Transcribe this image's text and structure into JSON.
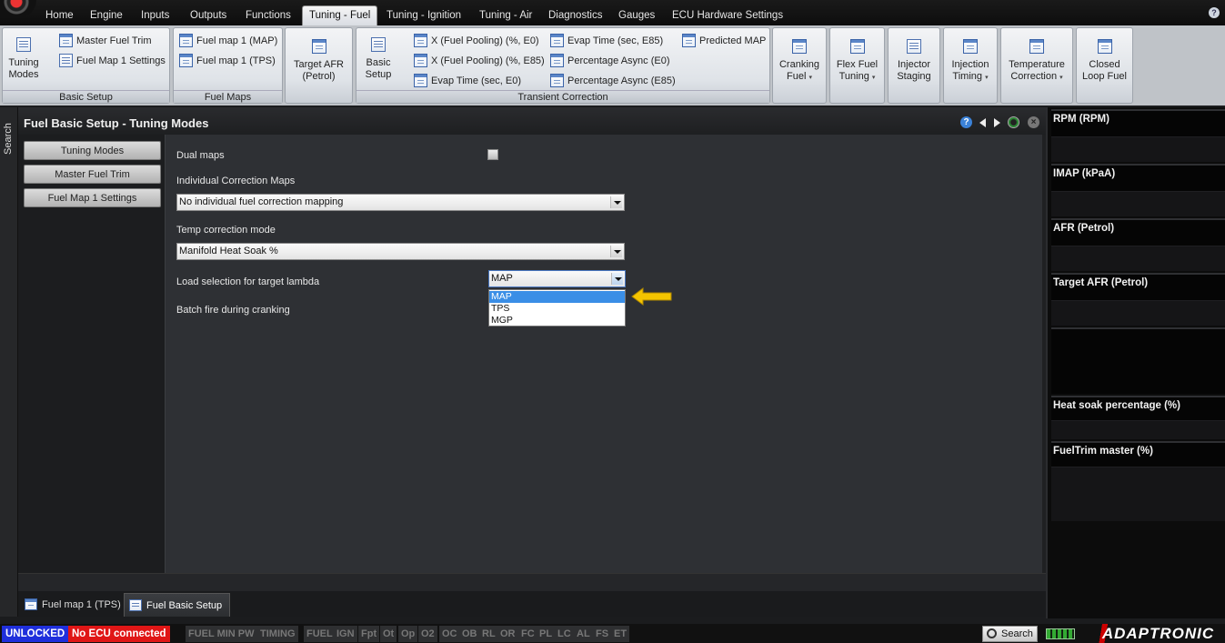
{
  "menu": {
    "tabs": [
      "Home",
      "Engine",
      "Inputs",
      "Outputs",
      "Functions",
      "Tuning - Fuel",
      "Tuning - Ignition",
      "Tuning - Air",
      "Diagnostics",
      "Gauges",
      "ECU Hardware Settings"
    ],
    "active_tab": "Tuning - Fuel",
    "help_icon": "?"
  },
  "ribbon": {
    "basic_setup": {
      "label": "Basic Setup",
      "tuning_modes": [
        "Tuning",
        "Modes"
      ],
      "master_fuel_trim": "Master Fuel Trim",
      "fuel_map_1_settings": "Fuel Map 1 Settings"
    },
    "fuel_maps": {
      "label": "Fuel Maps",
      "map": "Fuel map 1 (MAP)",
      "tps": "Fuel map 1 (TPS)"
    },
    "target_afr": [
      "Target AFR",
      "(Petrol)"
    ],
    "transient": {
      "label": "Transient Correction",
      "basic_setup": [
        "Basic",
        "Setup"
      ],
      "items": [
        "X (Fuel Pooling) (%, E0)",
        "X (Fuel Pooling) (%, E85)",
        "Evap Time (sec, E0)",
        "Evap Time (sec, E85)",
        "Percentage Async (E0)",
        "Percentage Async (E85)",
        "Predicted MAP"
      ]
    },
    "cranking_fuel": [
      "Cranking",
      "Fuel"
    ],
    "flex_fuel": [
      "Flex Fuel",
      "Tuning"
    ],
    "injector_staging": [
      "Injector",
      "Staging"
    ],
    "injection_timing": [
      "Injection",
      "Timing"
    ],
    "temperature_correction": [
      "Temperature",
      "Correction"
    ],
    "closed_loop": [
      "Closed",
      "Loop Fuel"
    ],
    "dropdown_caret": "▾"
  },
  "sidebar": {
    "search_label": "Search"
  },
  "panel": {
    "title": "Fuel Basic Setup - Tuning Modes",
    "help_icon": "?",
    "close_icon": "×",
    "nav": [
      "Tuning Modes",
      "Master Fuel Trim",
      "Fuel Map 1 Settings"
    ],
    "form": {
      "dual_maps": "Dual maps",
      "individual_correction_maps": "Individual Correction Maps",
      "individual_correction_value": "No individual fuel correction mapping",
      "temp_correction_mode": "Temp correction mode",
      "temp_correction_value": "Manifold Heat Soak %",
      "load_selection": "Load selection for target lambda",
      "load_selection_value": "MAP",
      "load_selection_options": [
        "MAP",
        "TPS",
        "MGP"
      ],
      "batch_fire": "Batch fire during cranking"
    },
    "bottom_tabs": [
      "Fuel map 1 (TPS)",
      "Fuel Basic Setup"
    ]
  },
  "gauges": [
    "RPM (RPM)",
    "IMAP  (kPaA)",
    "AFR (Petrol)",
    "Target AFR (Petrol)",
    "",
    "Heat soak percentage (%)",
    "FuelTrim master (%)"
  ],
  "status": {
    "unlocked": "UNLOCKED",
    "ecu": "No ECU connected",
    "flags": [
      "FUEL MIN PW",
      "TIMING",
      "FUEL",
      "IGN",
      "Fpt",
      "Ot",
      "Op",
      "O2",
      "OC",
      "OB",
      "RL",
      "OR",
      "FC",
      "PL",
      "LC",
      "AL",
      "FS",
      "ET"
    ],
    "search": "Search",
    "brand": "ADAPTRONIC"
  },
  "colors": {
    "unlocked_bg": "#1f2fdc",
    "no_ecu_bg": "#e01616",
    "selection_blue": "#3a8ee6",
    "annotation_arrow": "#f4c400"
  }
}
